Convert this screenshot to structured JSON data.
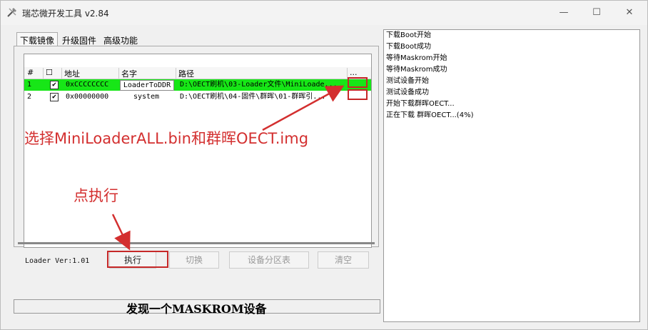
{
  "window": {
    "title": "瑞芯微开发工具 v2.84",
    "controls": {
      "minimize": "—",
      "maximize": "☐",
      "close": "✕"
    }
  },
  "tabs": [
    "下载镜像",
    "升级固件",
    "高级功能"
  ],
  "table": {
    "headers": [
      "#",
      "☐",
      "地址",
      "名字",
      "路径",
      "..."
    ],
    "rows": [
      {
        "num": "1",
        "checked": "✔",
        "address": "0xCCCCCCCC",
        "name": "LoaderToDDR",
        "path": "D:\\OECT刷机\\03-Loader文件\\MiniLoade...",
        "selected": true
      },
      {
        "num": "2",
        "checked": "✔",
        "address": "0x00000000",
        "name": "system",
        "path": "D:\\OECT刷机\\04-固件\\群晖\\01-群晖引...",
        "selected": false
      }
    ]
  },
  "loader_version": "Loader Ver:1.01",
  "buttons": {
    "run": "执行",
    "switch": "切换",
    "partition": "设备分区表",
    "clear": "清空"
  },
  "status_text": "发现一个MASKROM设备",
  "log_lines": [
    "下载Boot开始",
    "下载Boot成功",
    "等待Maskrom开始",
    "等待Maskrom成功",
    "测试设备开始",
    "测试设备成功",
    "开始下载群晖OECT...",
    "正在下载 群晖OECT...(4%)"
  ],
  "annotations": {
    "select_files": "选择MiniLoaderALL.bin和群晖OECT.img",
    "click_run": "点执行"
  },
  "colors": {
    "selected_row": "#17e617",
    "annotation": "#d32f2f"
  }
}
